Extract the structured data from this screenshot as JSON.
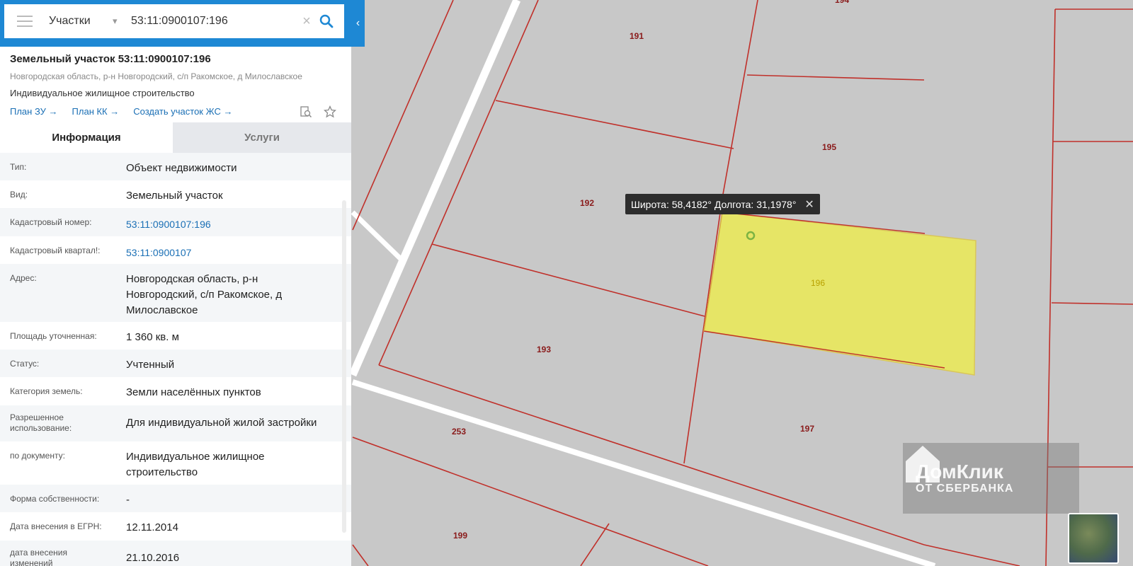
{
  "search": {
    "category": "Участки",
    "query": "53:11:0900107:196"
  },
  "parcel": {
    "title": "Земельный участок 53:11:0900107:196",
    "address": "Новгородская область, р-н Новгородский, с/п Ракомское, д Милославское",
    "usage": "Индивидуальное жилищное строительство",
    "links": [
      "План ЗУ →",
      "План КК →",
      "Создать участок ЖС →"
    ]
  },
  "tabs": [
    "Информация",
    "Услуги"
  ],
  "info_rows": [
    {
      "key": "Тип:",
      "value": "Объект недвижимости",
      "link": false
    },
    {
      "key": "Вид:",
      "value": "Земельный участок",
      "link": false
    },
    {
      "key": "Кадастровый номер:",
      "value": "53:11:0900107:196",
      "link": true
    },
    {
      "key": "Кадастровый квартал!:",
      "value": "53:11:0900107",
      "link": true
    },
    {
      "key": "Адрес:",
      "value": "Новгородская область, р-н Новгородский, с/п Ракомское, д Милославское",
      "link": false
    },
    {
      "key": "Площадь уточненная:",
      "value": "1 360 кв. м",
      "link": false
    },
    {
      "key": "Статус:",
      "value": "Учтенный",
      "link": false
    },
    {
      "key": "Категория земель:",
      "value": "Земли населённых пунктов",
      "link": false
    },
    {
      "key": "Разрешенное использование:",
      "value": "Для индивидуальной жилой застройки",
      "link": false
    },
    {
      "key": "по документу:",
      "value": "Индивидуальное жилищное строительство",
      "link": false
    },
    {
      "key": "Форма собственности:",
      "value": "-",
      "link": false
    },
    {
      "key": "Дата внесения в ЕГРН:",
      "value": "12.11.2014",
      "link": false
    },
    {
      "key": "дата внесения изменений",
      "value": "21.10.2016",
      "link": false
    }
  ],
  "map": {
    "tooltip": "Широта: 58,4182° Долгота: 31,1978°",
    "parcel_labels": [
      "194",
      "191",
      "195",
      "192",
      "196",
      "193",
      "197",
      "253",
      "199"
    ],
    "selected_label": "196"
  },
  "watermark": {
    "main": "ДомКлик",
    "sub": "ОТ СБЕРБАНКА"
  },
  "colors": {
    "header_blue": "#1e88d4",
    "link_blue": "#1a6fb5",
    "parcel_line": "#c0302a",
    "selected_fill": "#e6e566"
  }
}
